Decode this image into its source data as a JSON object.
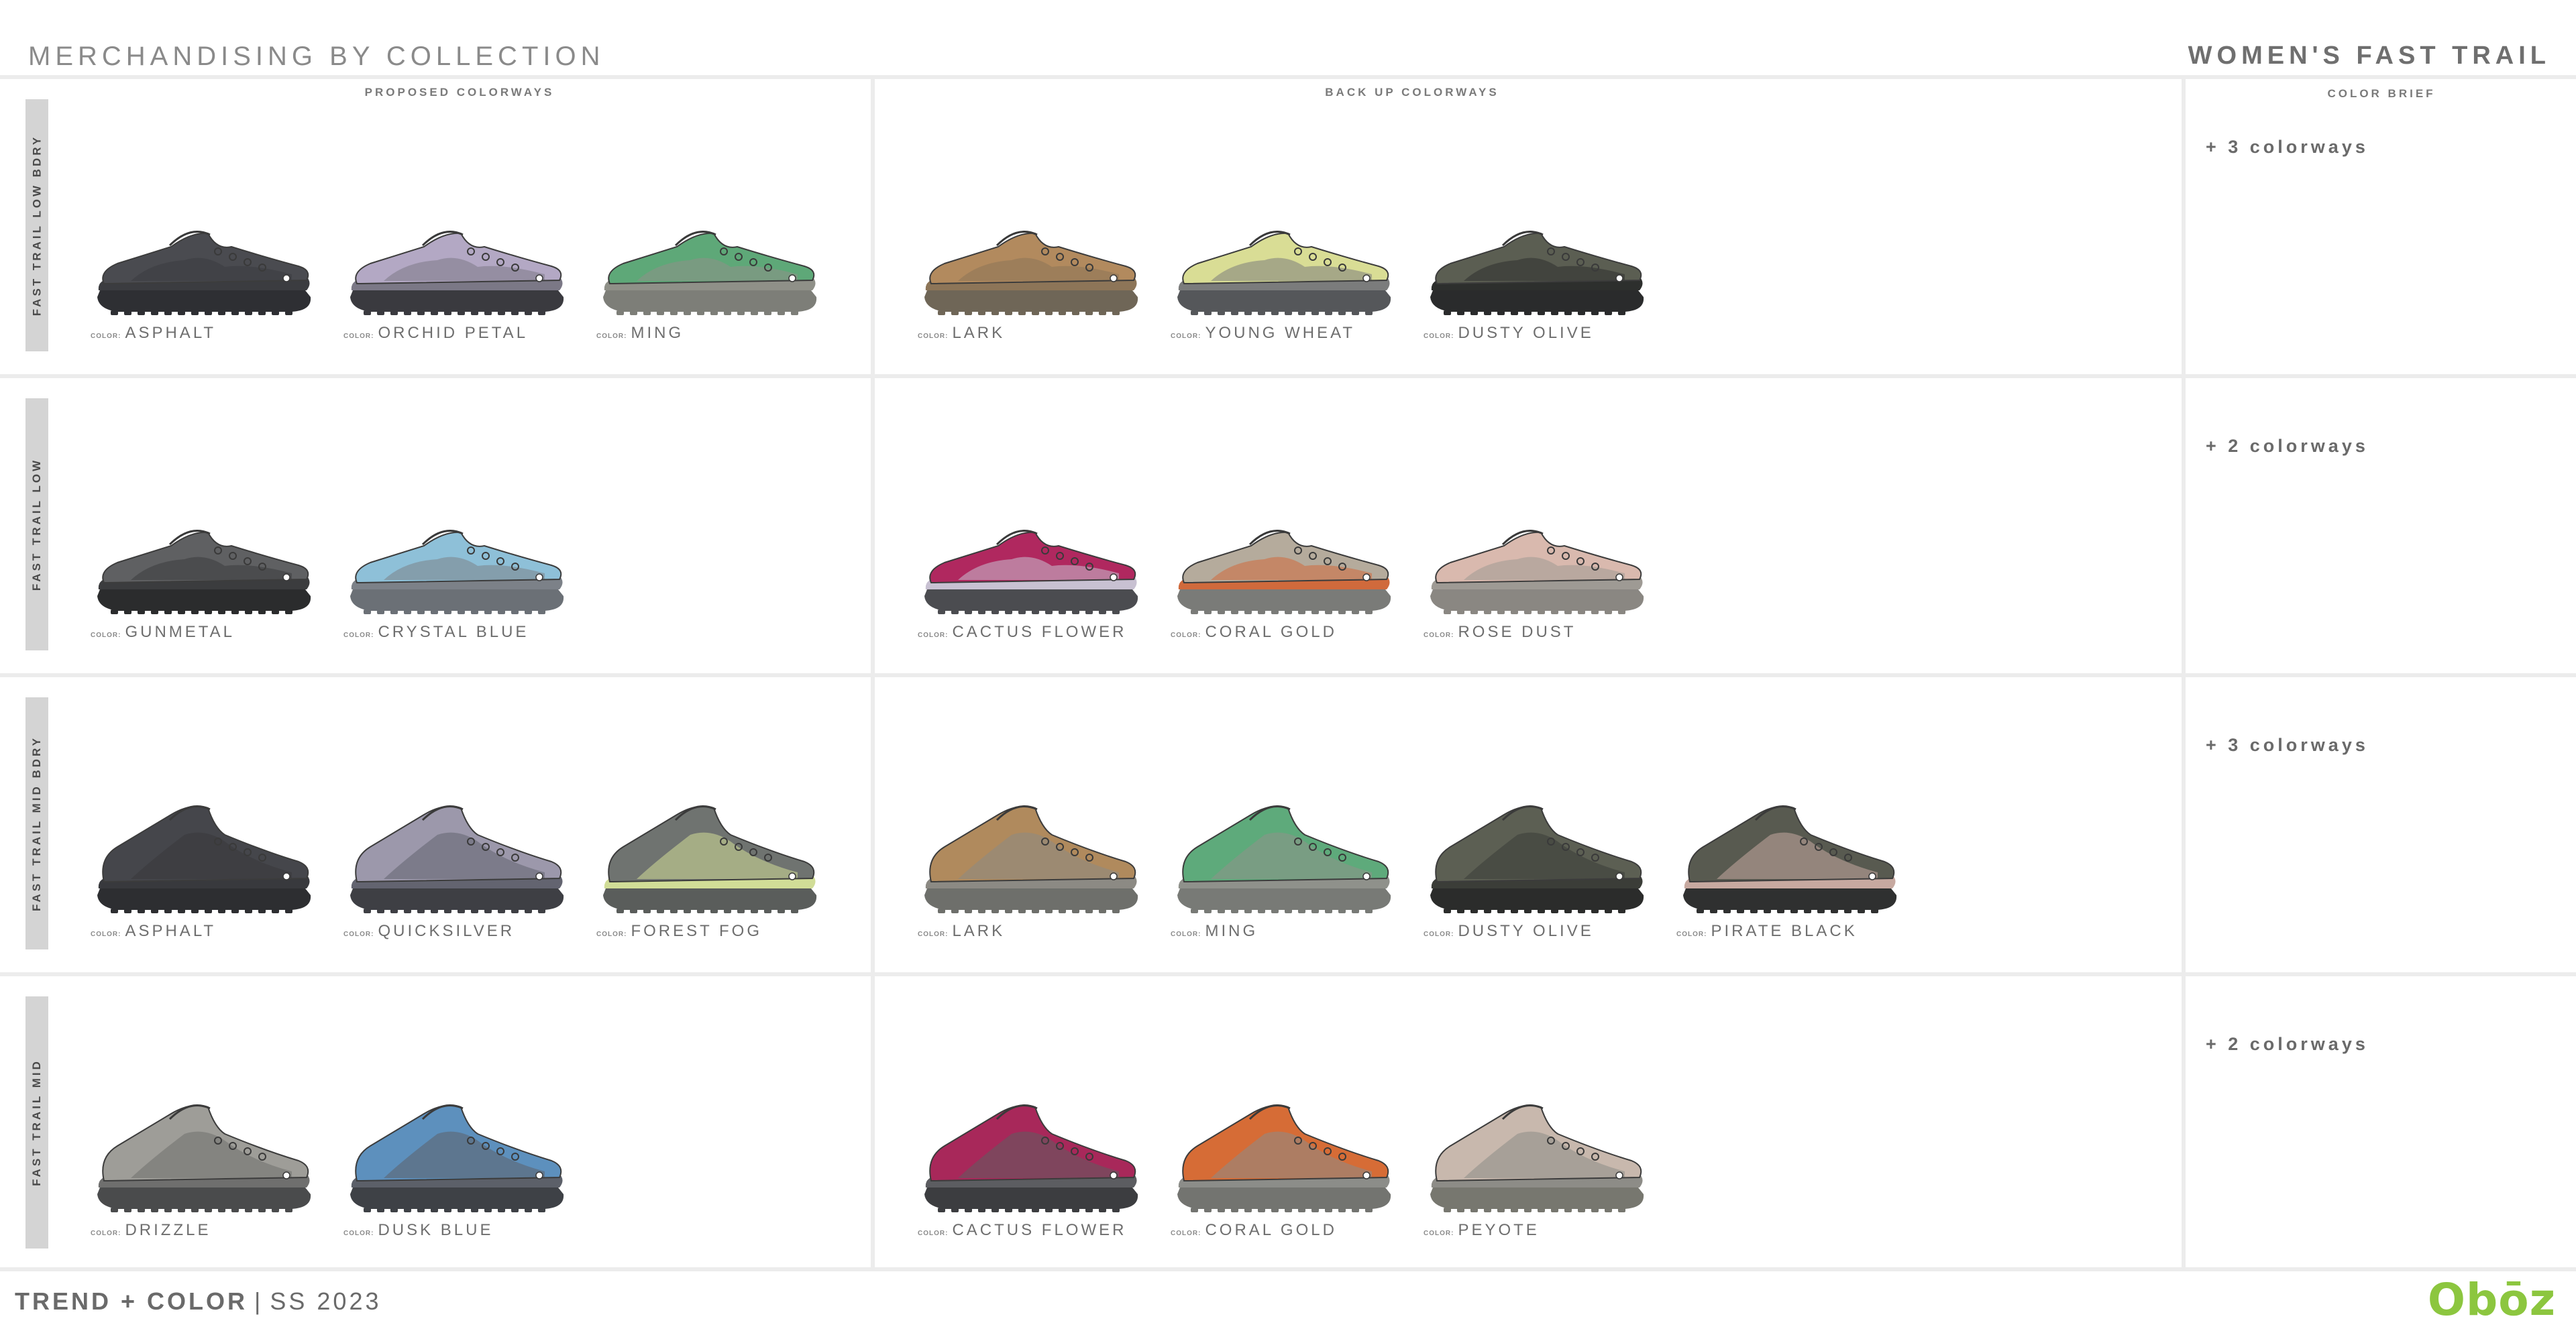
{
  "header": {
    "page_title": "MERCHANDISING BY COLLECTION",
    "collection_title": "WOMEN'S FAST TRAIL"
  },
  "columns": {
    "proposed": "PROPOSED COLORWAYS",
    "backup": "BACK UP COLORWAYS",
    "brief": "COLOR BRIEF"
  },
  "color_label": "COLOR:",
  "rows": [
    {
      "name": "FAST TRAIL LOW BDRY",
      "style": "low",
      "brief": "+ 3 colorways",
      "proposed": [
        {
          "name": "ASPHALT",
          "upper": "#4a4b50",
          "accent": "#3b3c40",
          "sole": "#2e2f33"
        },
        {
          "name": "ORCHID PETAL",
          "upper": "#b3a8c4",
          "accent": "#7b7886",
          "sole": "#3a3a3f"
        },
        {
          "name": "MING",
          "upper": "#5ea878",
          "accent": "#8f9088",
          "sole": "#7d7e78"
        }
      ],
      "backup": [
        {
          "name": "LARK",
          "upper": "#b28a5e",
          "accent": "#8d7558",
          "sole": "#6f6657"
        },
        {
          "name": "YOUNG WHEAT",
          "upper": "#d9dd95",
          "accent": "#7b7c7c",
          "sole": "#55575a"
        },
        {
          "name": "DUSTY OLIVE",
          "upper": "#5b5e52",
          "accent": "#2d2f2d",
          "sole": "#2a2b2c"
        }
      ]
    },
    {
      "name": "FAST TRAIL LOW",
      "style": "low",
      "brief": "+ 2 colorways",
      "proposed": [
        {
          "name": "GUNMETAL",
          "upper": "#5f6062",
          "accent": "#3b3c3e",
          "sole": "#2b2c2d"
        },
        {
          "name": "CRYSTAL BLUE",
          "upper": "#8ec0d8",
          "accent": "#7c8188",
          "sole": "#6b7076"
        }
      ],
      "backup": [
        {
          "name": "CACTUS FLOWER",
          "upper": "#b0285f",
          "accent": "#c8c1d2",
          "sole": "#4b4c50"
        },
        {
          "name": "CORAL GOLD",
          "upper": "#b5ab9c",
          "accent": "#d06a3c",
          "sole": "#7a7b78"
        },
        {
          "name": "ROSE DUST",
          "upper": "#d9b9ae",
          "accent": "#9e9a94",
          "sole": "#8a8782"
        }
      ]
    },
    {
      "name": "FAST TRAIL MID BDRY",
      "style": "mid",
      "brief": "+ 3 colorways",
      "proposed": [
        {
          "name": "ASPHALT",
          "upper": "#45464b",
          "accent": "#38393d",
          "sole": "#2d2e31"
        },
        {
          "name": "QUICKSILVER",
          "upper": "#9c98ab",
          "accent": "#636470",
          "sole": "#3e3f44"
        },
        {
          "name": "FOREST FOG",
          "upper": "#6f7370",
          "accent": "#d1dd97",
          "sole": "#5a5d5b"
        }
      ],
      "backup": [
        {
          "name": "LARK",
          "upper": "#b08a5d",
          "accent": "#8c8a84",
          "sole": "#6e6f6b"
        },
        {
          "name": "MING",
          "upper": "#5eaa7b",
          "accent": "#8f918b",
          "sole": "#787a76"
        },
        {
          "name": "DUSTY OLIVE",
          "upper": "#5c5f53",
          "accent": "#3b3d38",
          "sole": "#2b2c2b"
        },
        {
          "name": "PIRATE BLACK",
          "upper": "#585a50",
          "accent": "#c7a9a0",
          "sole": "#2f3030"
        }
      ]
    },
    {
      "name": "FAST TRAIL MID",
      "style": "mid",
      "brief": "+ 2 colorways",
      "proposed": [
        {
          "name": "DRIZZLE",
          "upper": "#9e9d98",
          "accent": "#6f6f6e",
          "sole": "#4a4b4c"
        },
        {
          "name": "DUSK BLUE",
          "upper": "#5d90bd",
          "accent": "#5c6069",
          "sole": "#3e4146"
        }
      ],
      "backup": [
        {
          "name": "CACTUS FLOWER",
          "upper": "#a8285a",
          "accent": "#5c5d61",
          "sole": "#3c3d40"
        },
        {
          "name": "CORAL GOLD",
          "upper": "#d66c36",
          "accent": "#8c8d89",
          "sole": "#737470"
        },
        {
          "name": "PEYOTE",
          "upper": "#c8b8ad",
          "accent": "#8d8c87",
          "sole": "#77776f"
        }
      ]
    }
  ],
  "footer": {
    "trend": "TREND + COLOR",
    "divider": "|",
    "season": "SS 2023",
    "logo": "Obōz"
  }
}
